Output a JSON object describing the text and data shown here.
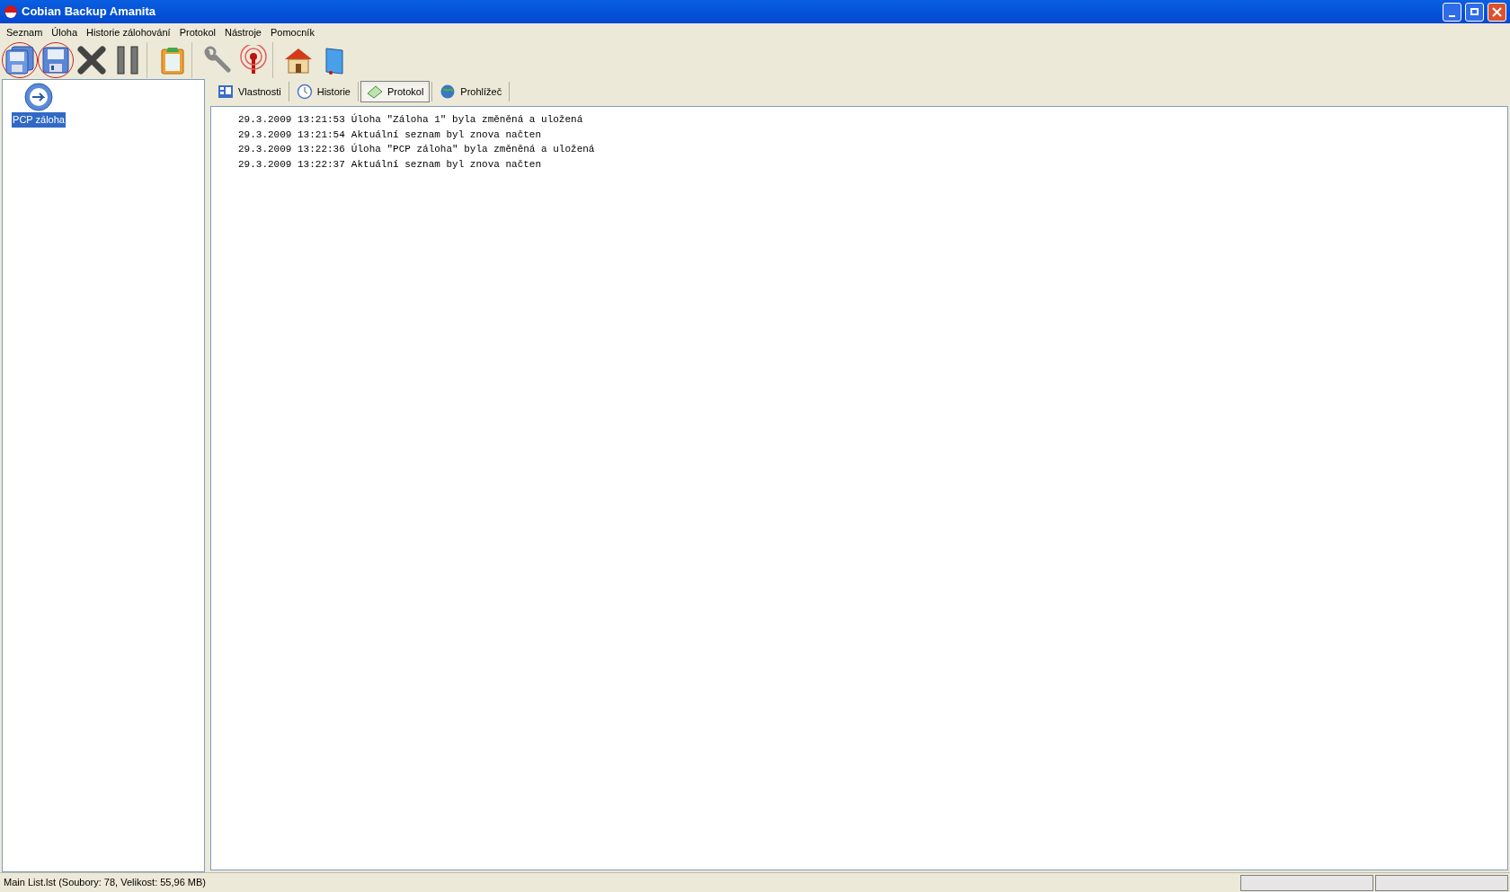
{
  "window": {
    "title": "Cobian Backup Amanita"
  },
  "menu": [
    "Seznam",
    "Úloha",
    "Historie zálohování",
    "Protokol",
    "Nástroje",
    "Pomocník"
  ],
  "toolbar": [
    {
      "kind": "floppies",
      "circled": true,
      "separator_before": false
    },
    {
      "kind": "floppy",
      "circled": true,
      "separator_before": false
    },
    {
      "kind": "cross",
      "circled": false,
      "separator_before": false
    },
    {
      "kind": "pause",
      "circled": false,
      "separator_before": false
    },
    {
      "kind": "clipboard",
      "circled": false,
      "separator_before": true
    },
    {
      "kind": "wrench",
      "circled": false,
      "separator_before": true
    },
    {
      "kind": "antenna",
      "circled": false,
      "separator_before": false
    },
    {
      "kind": "house",
      "circled": false,
      "separator_before": true
    },
    {
      "kind": "book",
      "circled": false,
      "separator_before": false
    }
  ],
  "tree": [
    {
      "label": "PCP záloha",
      "selected": true
    }
  ],
  "tabs": [
    {
      "label": "Vlastnosti",
      "kind": "grid",
      "selected": false
    },
    {
      "label": "Historie",
      "kind": "clock",
      "selected": false
    },
    {
      "label": "Protokol",
      "kind": "note",
      "selected": true
    },
    {
      "label": "Prohlížeč",
      "kind": "globe",
      "selected": false
    }
  ],
  "log": [
    {
      "time": "29.3.2009 13:21:53",
      "text": "Úloha \"Záloha 1\" byla změněná a uložená"
    },
    {
      "time": "29.3.2009 13:21:54",
      "text": "Aktuální seznam byl znova načten"
    },
    {
      "time": "29.3.2009 13:22:36",
      "text": "Úloha \"PCP záloha\" byla změněná a uložená"
    },
    {
      "time": "29.3.2009 13:22:37",
      "text": "Aktuální seznam byl znova načten"
    }
  ],
  "status_bar": {
    "text": "Main List.lst (Soubory: 78, Velikost: 55,96 MB)"
  }
}
